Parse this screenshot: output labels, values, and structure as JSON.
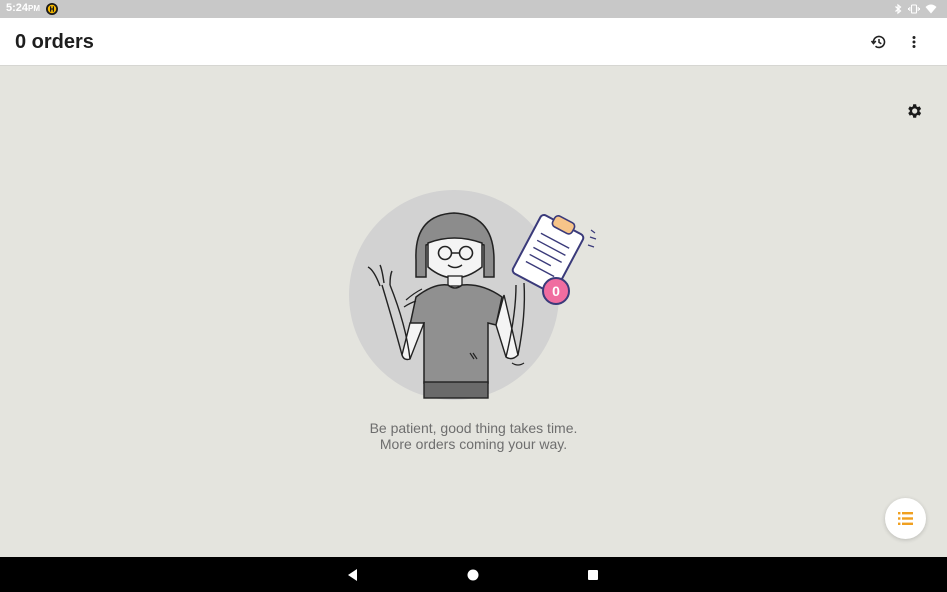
{
  "status_bar": {
    "time": "5:24",
    "ampm": "PM",
    "icons": [
      "app-notification-icon",
      "bluetooth-icon",
      "vibrate-icon",
      "wifi-icon"
    ]
  },
  "app_bar": {
    "title": "0 orders",
    "actions": [
      "history-icon",
      "more-vert-icon"
    ]
  },
  "main": {
    "settings_icon": "gear-icon",
    "badge_count": "0",
    "message_line1": "Be patient, good thing takes time.",
    "message_line2": "More orders coming your way.",
    "fab_icon": "list-icon"
  },
  "nav_bar": {
    "buttons": [
      "back-icon",
      "home-icon",
      "recents-icon"
    ]
  },
  "colors": {
    "background": "#e4e4de",
    "accent": "#f0a020",
    "badge": "#f06da0",
    "status_bar": "#c8c8c8"
  }
}
